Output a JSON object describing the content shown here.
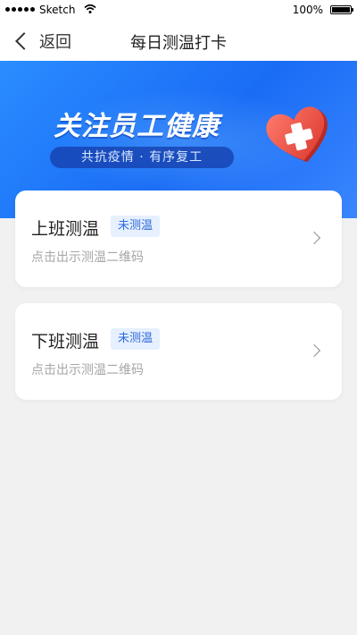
{
  "status_bar": {
    "carrier": "Sketch",
    "battery": "100%"
  },
  "nav": {
    "back_label": "返回",
    "title": "每日测温打卡"
  },
  "banner": {
    "title": "关注员工健康",
    "subtitle": "共抗疫情 · 有序复工"
  },
  "cards": [
    {
      "title": "上班测温",
      "badge": "未测温",
      "hint": "点击出示测温二维码"
    },
    {
      "title": "下班测温",
      "badge": "未测温",
      "hint": "点击出示测温二维码"
    }
  ],
  "colors": {
    "accent": "#1a6cf5",
    "badge_text": "#2f6bd8",
    "badge_bg": "#e6f0ff",
    "heart": "#e8473d"
  }
}
